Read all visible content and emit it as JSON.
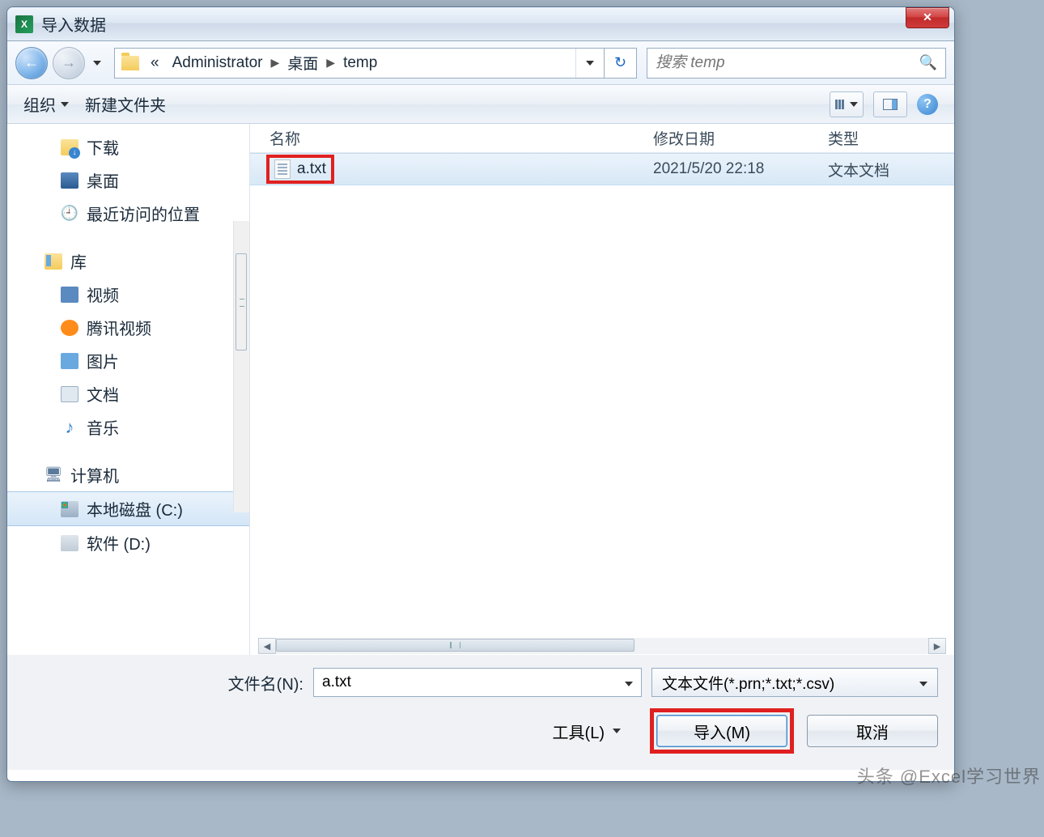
{
  "window": {
    "title": "导入数据"
  },
  "breadcrumbs": {
    "prefix": "«",
    "items": [
      "Administrator",
      "桌面",
      "temp"
    ]
  },
  "search": {
    "placeholder": "搜索 temp"
  },
  "toolbar": {
    "organize": "组织",
    "newfolder": "新建文件夹"
  },
  "sidebar": {
    "downloads": "下载",
    "desktop": "桌面",
    "recent": "最近访问的位置",
    "libraries": "库",
    "video": "视频",
    "tencent": "腾讯视频",
    "pictures": "图片",
    "documents": "文档",
    "music": "音乐",
    "computer": "计算机",
    "cdrive": "本地磁盘 (C:)",
    "ddrive": "软件 (D:)"
  },
  "columns": {
    "name": "名称",
    "modified": "修改日期",
    "type": "类型"
  },
  "files": [
    {
      "name": "a.txt",
      "modified": "2021/5/20 22:18",
      "type": "文本文档"
    }
  ],
  "form": {
    "filename_label": "文件名(N):",
    "filename_value": "a.txt",
    "filter": "文本文件(*.prn;*.txt;*.csv)",
    "tools": "工具(L)",
    "import": "导入(M)",
    "cancel": "取消"
  },
  "watermark": "头条 @Excel学习世界"
}
